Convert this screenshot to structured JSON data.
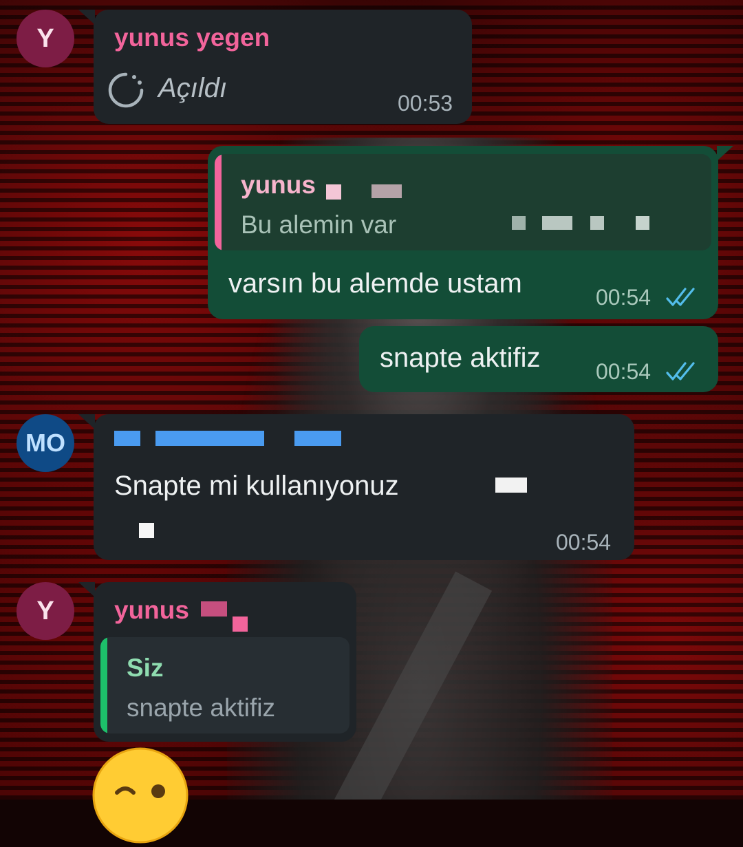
{
  "messages": [
    {
      "sender_initial": "Y",
      "sender": "yunus yegen",
      "status_text": "Açıldı",
      "status_icon": "view-once-opened-icon",
      "time": "00:53"
    },
    {
      "quote_title": "yunus",
      "quote_text": "Bu alemin var",
      "text": "varsın bu alemde ustam",
      "time": "00:54",
      "status_icon": "double-check-icon"
    },
    {
      "text": "snapte aktifiz",
      "time": "00:54",
      "status_icon": "double-check-icon"
    },
    {
      "sender_initial": "MO",
      "text": "Snapte mi kullanıyonuz",
      "time": "00:54"
    },
    {
      "sender_initial": "Y",
      "sender": "yunus",
      "quote_title": "Siz",
      "quote_text": "snapte aktifiz",
      "emoji": "😉"
    }
  ],
  "colors": {
    "incoming_bubble": "#1f2428",
    "outgoing_bubble": "#134d37",
    "sender_name": "#f2649b",
    "read_ticks": "#53bdeb",
    "quote_self_bar": "#1dbf6a",
    "quote_other_bar": "#f2649b"
  }
}
